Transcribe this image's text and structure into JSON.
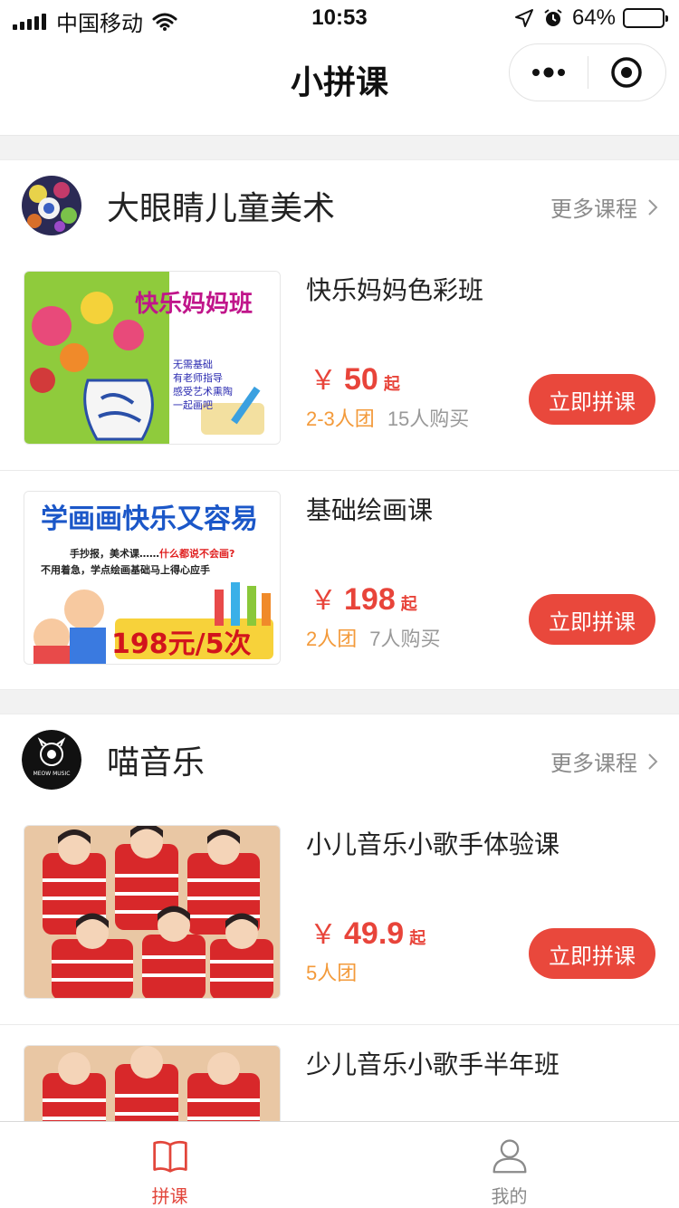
{
  "status_bar": {
    "carrier": "中国移动",
    "time": "10:53",
    "battery": "64%",
    "battery_level": 0.64
  },
  "nav": {
    "title": "小拼课"
  },
  "orgs": [
    {
      "name": "大眼睛儿童美术",
      "more_label": "更多课程",
      "courses": [
        {
          "title": "快乐妈妈色彩班",
          "currency": "￥",
          "price": "50",
          "price_suffix": "起",
          "group": "2-3人团",
          "buyers": "15人购买",
          "button": "立即拼课",
          "thumb_text": "快乐妈妈班",
          "thumb_lines": [
            "无需基础",
            "有老师指导",
            "感受艺术熏陶",
            "一起画吧"
          ]
        },
        {
          "title": "基础绘画课",
          "currency": "￥",
          "price": "198",
          "price_suffix": "起",
          "group": "2人团",
          "buyers": "7人购买",
          "button": "立即拼课",
          "thumb_text": "学画画快乐又容易",
          "thumb_line1_a": "手抄报，美术课……",
          "thumb_line1_b": "什么都说不会画?",
          "thumb_line2": "不用着急，学点绘画基础马上得心应手",
          "thumb_promo": "198元/5次"
        }
      ]
    },
    {
      "name": "喵音乐",
      "logo_text": "MEOW MUSIC",
      "more_label": "更多课程",
      "courses": [
        {
          "title": "小儿音乐小歌手体验课",
          "currency": "￥",
          "price": "49.9",
          "price_suffix": "起",
          "group": "5人团",
          "buyers": "",
          "button": "立即拼课"
        },
        {
          "title": "少儿音乐小歌手半年班"
        }
      ]
    }
  ],
  "tabbar": {
    "items": [
      {
        "label": "拼课",
        "icon": "book-icon",
        "active": true
      },
      {
        "label": "我的",
        "icon": "person-icon",
        "active": false
      }
    ]
  },
  "colors": {
    "accent": "#e9483c",
    "group_text": "#f39a3a",
    "muted": "#999999"
  }
}
